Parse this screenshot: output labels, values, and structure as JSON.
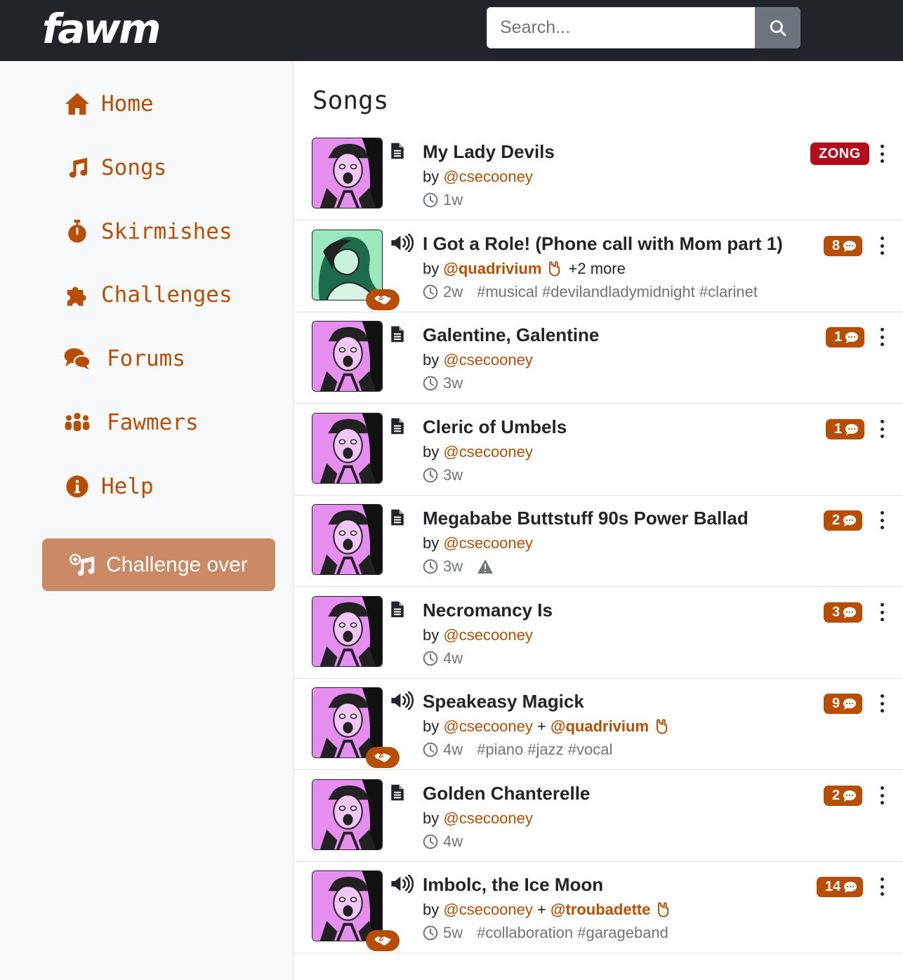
{
  "header": {
    "logo": "fawm",
    "search_placeholder": "Search..."
  },
  "sidebar": {
    "items": [
      {
        "label": "Home",
        "icon": "home-icon"
      },
      {
        "label": "Songs",
        "icon": "music-note-icon"
      },
      {
        "label": "Skirmishes",
        "icon": "stopwatch-icon"
      },
      {
        "label": "Challenges",
        "icon": "puzzle-icon"
      },
      {
        "label": "Forums",
        "icon": "comments-icon"
      },
      {
        "label": "Fawmers",
        "icon": "users-icon"
      },
      {
        "label": "Help",
        "icon": "info-icon"
      }
    ],
    "challenge_button": "Challenge over"
  },
  "main": {
    "title": "Songs",
    "songs": [
      {
        "title": "My Lady Devils",
        "by": "by",
        "users": [
          "@csecooney"
        ],
        "time": "1w",
        "type": "lyrics",
        "badge": "ZONG"
      },
      {
        "title": "I Got a Role! (Phone call with Mom part 1)",
        "by": "by",
        "users": [
          "@quadrivium"
        ],
        "more": "+2 more",
        "time": "2w",
        "tags": "#musical #devilandladymidnight #clarinet",
        "type": "audio",
        "count": "8"
      },
      {
        "title": "Galentine, Galentine",
        "by": "by",
        "users": [
          "@csecooney"
        ],
        "time": "3w",
        "type": "lyrics",
        "count": "1"
      },
      {
        "title": "Cleric of Umbels",
        "by": "by",
        "users": [
          "@csecooney"
        ],
        "time": "3w",
        "type": "lyrics",
        "count": "1"
      },
      {
        "title": "Megababe Buttstuff 90s Power Ballad",
        "by": "by",
        "users": [
          "@csecooney"
        ],
        "time": "3w",
        "type": "lyrics",
        "count": "2",
        "warning": true
      },
      {
        "title": "Necromancy Is",
        "by": "by",
        "users": [
          "@csecooney"
        ],
        "time": "4w",
        "type": "lyrics",
        "count": "3"
      },
      {
        "title": "Speakeasy Magick",
        "by": "by",
        "users": [
          "@csecooney",
          "@quadrivium"
        ],
        "joiner": "+",
        "time": "4w",
        "tags": "#piano #jazz #vocal",
        "type": "audio",
        "count": "9"
      },
      {
        "title": "Golden Chanterelle",
        "by": "by",
        "users": [
          "@csecooney"
        ],
        "time": "4w",
        "type": "lyrics",
        "count": "2"
      },
      {
        "title": "Imbolc, the Ice Moon",
        "by": "by",
        "users": [
          "@csecooney",
          "@troubadette"
        ],
        "joiner": "+",
        "time": "5w",
        "tags": "#collaboration #garageband",
        "type": "audio",
        "count": "14"
      }
    ]
  },
  "colors": {
    "accent": "#b84e04",
    "topbar": "#212529",
    "challenge": "#cb8a66",
    "zong": "#b30c1c"
  }
}
